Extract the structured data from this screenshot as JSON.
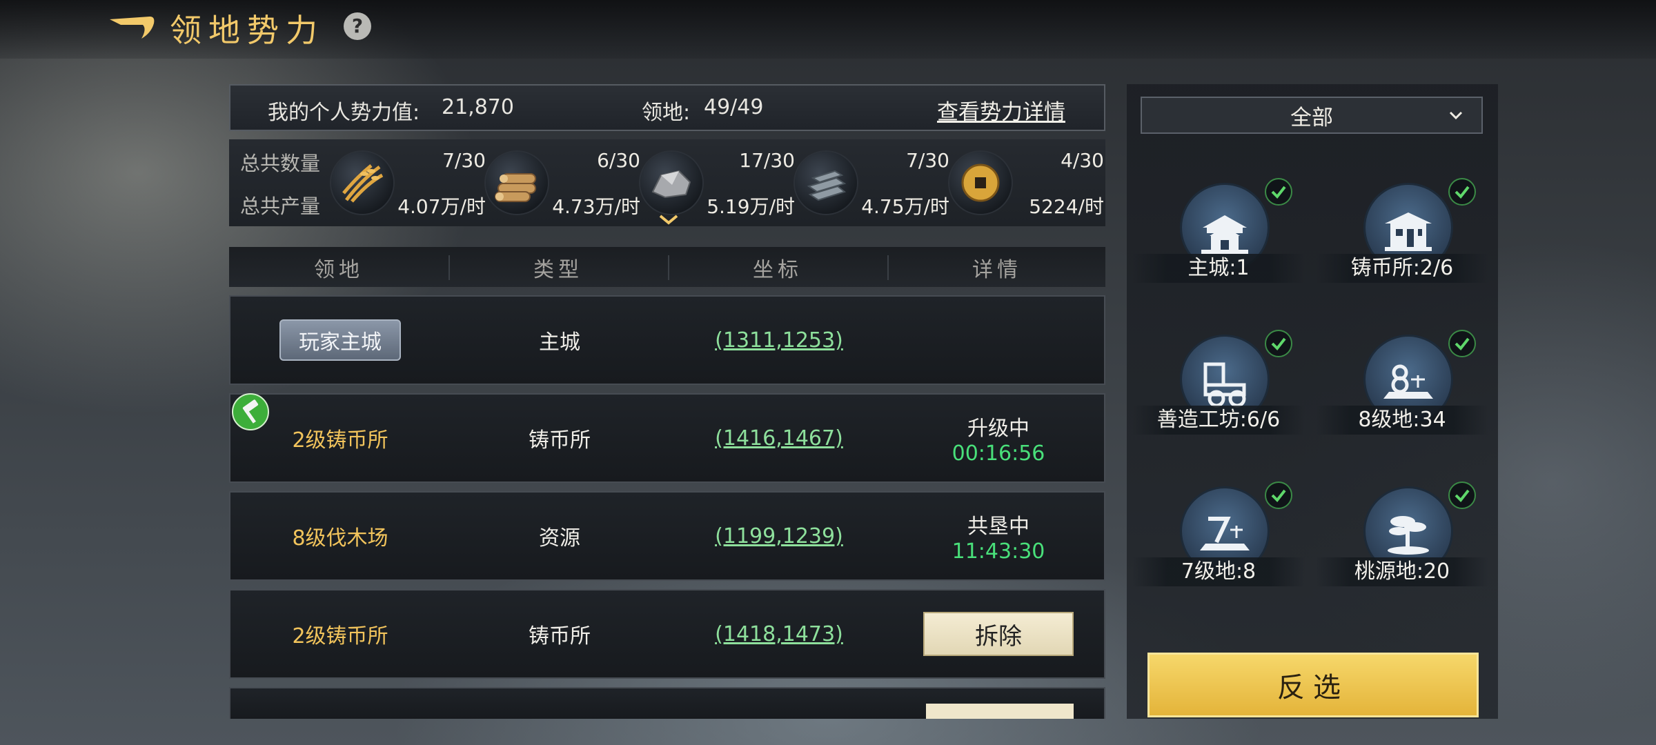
{
  "header": {
    "title": "领地势力",
    "back_icon": "back-arrow-icon",
    "help_icon": "?"
  },
  "summary": {
    "power_label": "我的个人势力值:",
    "power_value": "21,870",
    "territory_label": "领地:",
    "territory_value": "49/49",
    "detail_link": "查看势力详情"
  },
  "resources": {
    "count_label": "总共数量",
    "prod_label": "总共产量",
    "items": [
      {
        "icon": "grain-icon",
        "count": "7/30",
        "prod": "4.07万/时"
      },
      {
        "icon": "wood-icon",
        "count": "6/30",
        "prod": "4.73万/时"
      },
      {
        "icon": "stone-icon",
        "count": "17/30",
        "prod": "5.19万/时"
      },
      {
        "icon": "iron-icon",
        "count": "7/30",
        "prod": "4.75万/时"
      },
      {
        "icon": "coin-icon",
        "count": "4/30",
        "prod": "5224/时"
      }
    ]
  },
  "table": {
    "headers": [
      "领地",
      "类型",
      "坐标",
      "详情"
    ],
    "rows": [
      {
        "name": "玩家主城",
        "type": "主城",
        "coord": "(1311,1253)"
      },
      {
        "name": "2级铸币所",
        "type": "铸币所",
        "coord": "(1416,1467)",
        "status": "升级中",
        "timer": "00:16:56"
      },
      {
        "name": "8级伐木场",
        "type": "资源",
        "coord": "(1199,1239)",
        "status": "共垦中",
        "timer": "11:43:30"
      },
      {
        "name": "2级铸币所",
        "type": "铸币所",
        "coord": "(1418,1473)",
        "action": "拆除"
      }
    ]
  },
  "filter": {
    "selected": "全部",
    "categories": [
      {
        "label": "主城:1",
        "icon": "palace-icon",
        "checked": true
      },
      {
        "label": "铸币所:2/6",
        "icon": "mint-icon",
        "checked": true
      },
      {
        "label": "善造工坊:6/6",
        "icon": "workshop-icon",
        "checked": true
      },
      {
        "label": "8级地:34",
        "icon": "level-8-land-icon",
        "checked": true
      },
      {
        "label": "7级地:8",
        "icon": "level-7-land-icon",
        "checked": true
      },
      {
        "label": "桃源地:20",
        "icon": "peach-land-icon",
        "checked": true
      }
    ],
    "invert_label": "反选"
  },
  "colors": {
    "accent_gold": "#f2c96a",
    "coord_green": "#8ee09c",
    "timer_green": "#49e07a"
  }
}
